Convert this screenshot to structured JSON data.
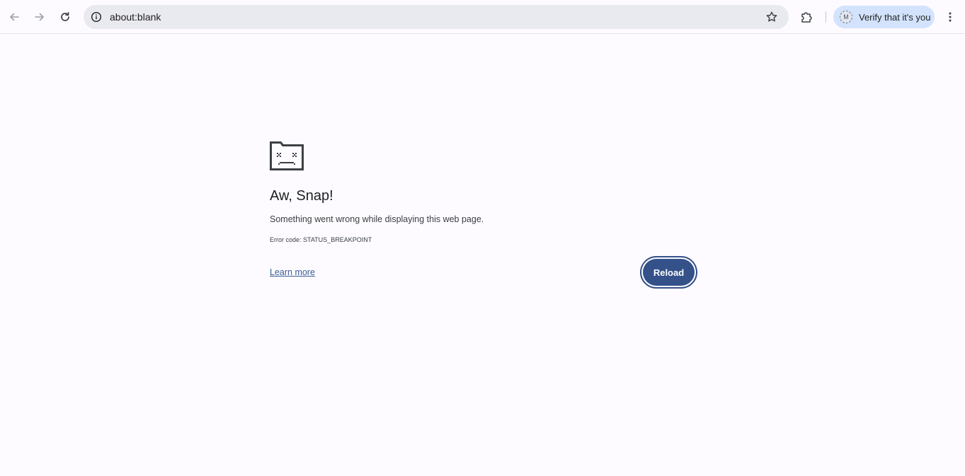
{
  "browser": {
    "url": "about:blank",
    "verify_label": "Verify that it's you",
    "avatar_initial": "M",
    "icons": {
      "back": "back-arrow-icon",
      "forward": "forward-arrow-icon",
      "reload": "reload-icon",
      "site_info": "info-icon",
      "bookmark": "star-icon",
      "extensions": "puzzle-piece-icon",
      "menu": "kebab-menu-icon"
    }
  },
  "error_page": {
    "icon": "sad-folder-icon",
    "title": "Aw, Snap!",
    "message": "Something went wrong while displaying this web page.",
    "error_code": "Error code: STATUS_BREAKPOINT",
    "learn_more": "Learn more",
    "reload_label": "Reload"
  },
  "colors": {
    "accent": "#34518a",
    "link": "#3c5d92",
    "omnibox_bg": "#e9e9f0",
    "verify_bg": "#d3e3fd",
    "page_bg": "#fdfbff"
  }
}
